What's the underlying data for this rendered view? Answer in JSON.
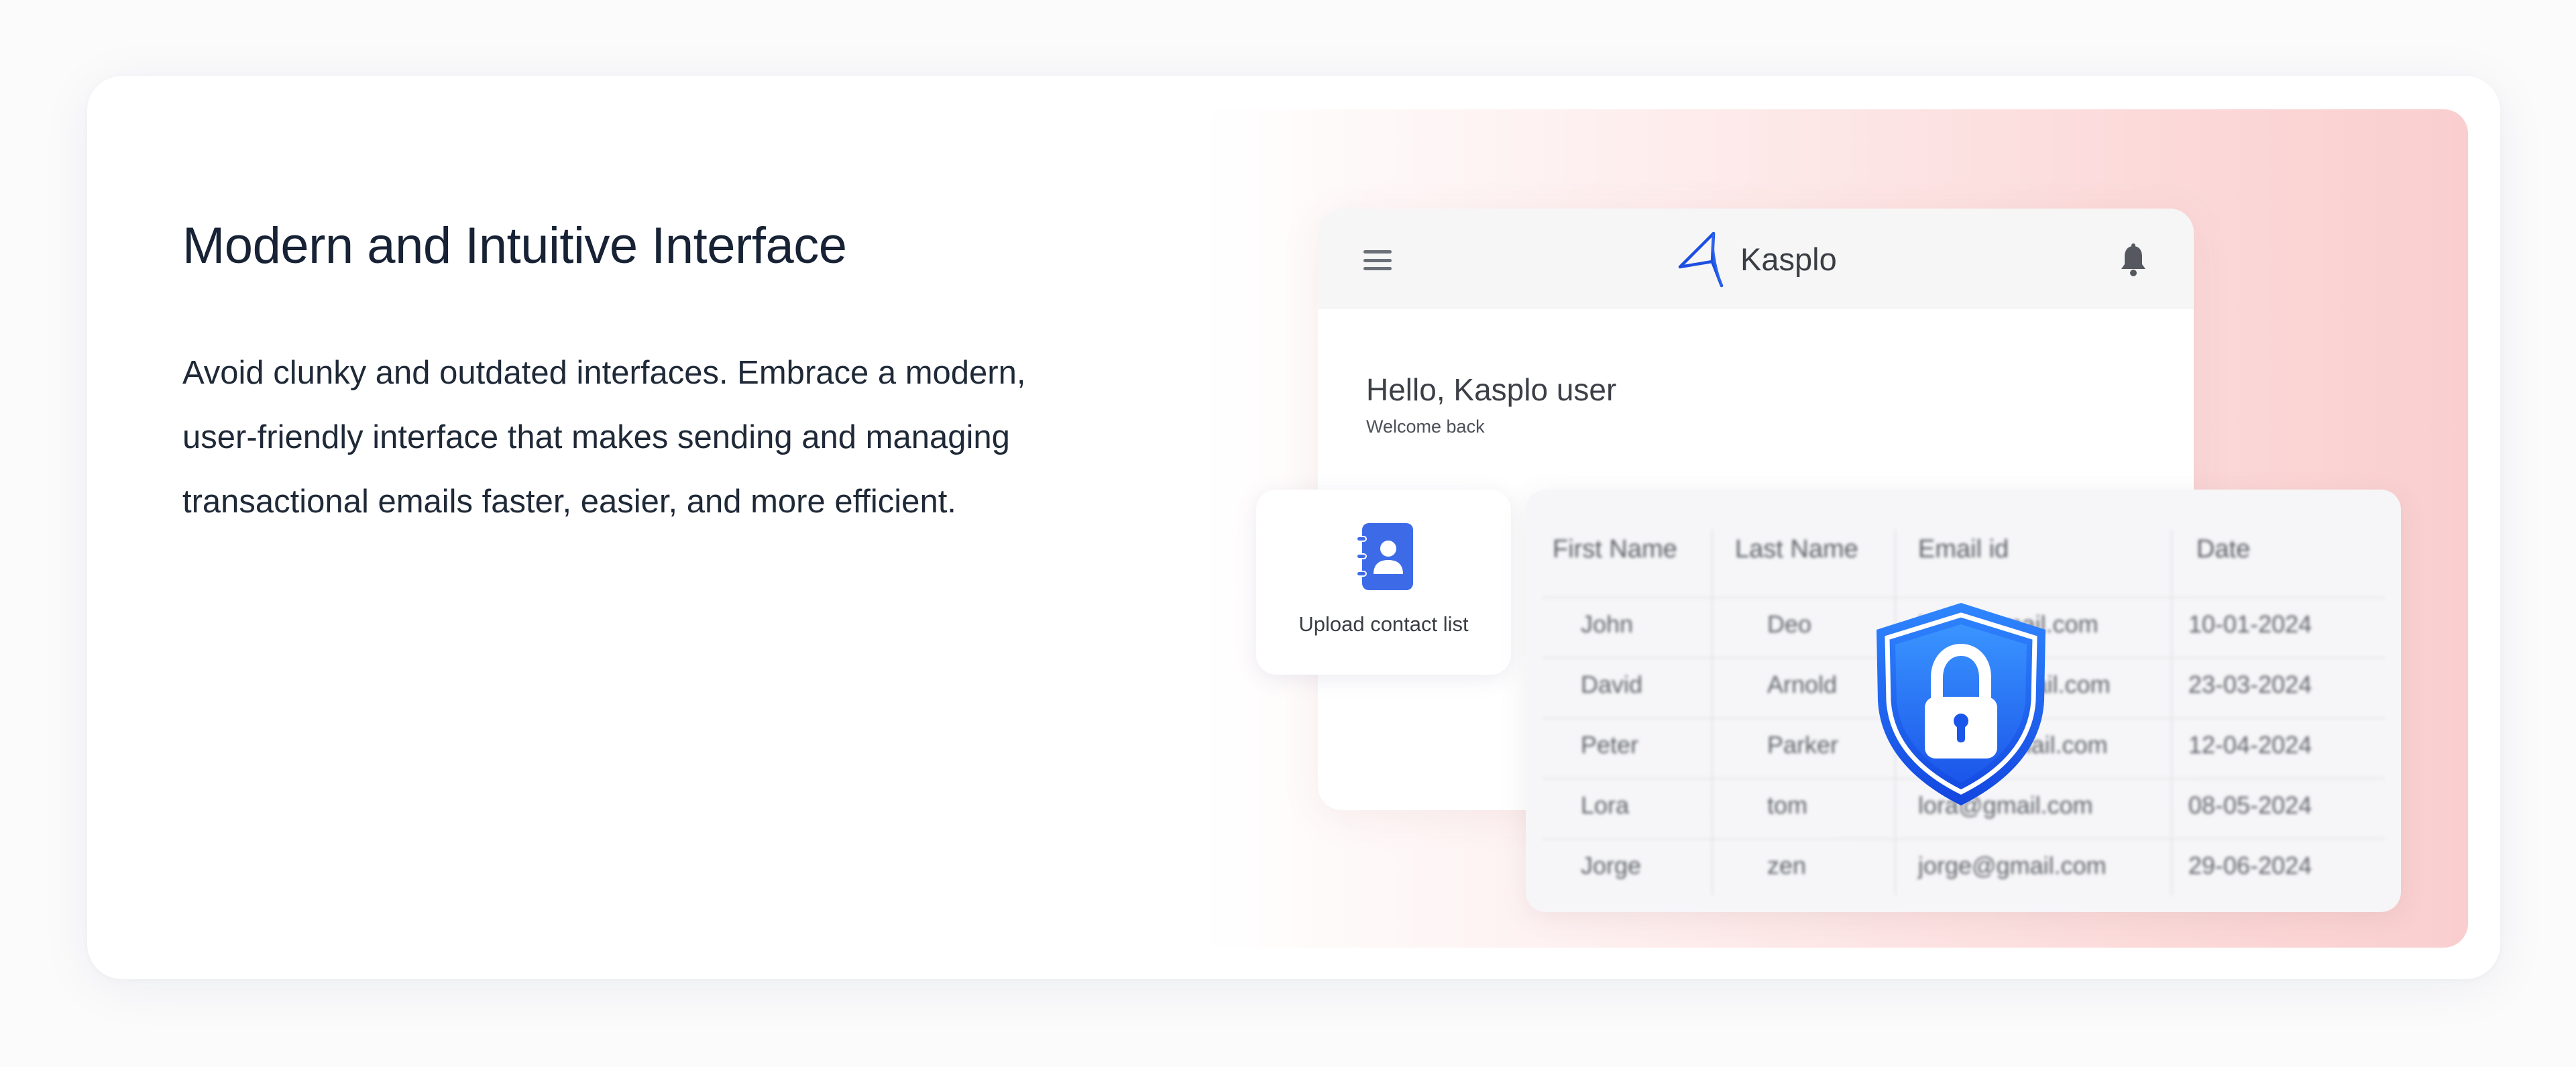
{
  "feature": {
    "title": "Modern and Intuitive Interface",
    "description": "Avoid clunky and outdated interfaces. Embrace a modern, user-friendly interface that makes sending and managing transactional emails faster, easier, and more efficient."
  },
  "app": {
    "brand_name": "Kasplo",
    "greeting": "Hello, Kasplo user",
    "welcome": "Welcome back",
    "upload_label": "Upload contact list"
  },
  "table": {
    "headers": [
      "First Name",
      "Last Name",
      "Email id",
      "Date"
    ],
    "rows": [
      [
        "John",
        "Deo",
        "john@gmail.com",
        "10-01-2024"
      ],
      [
        "David",
        "Arnold",
        "david@gmail.com",
        "23-03-2024"
      ],
      [
        "Peter",
        "Parker",
        "peter@gmail.com",
        "12-04-2024"
      ],
      [
        "Lora",
        "tom",
        "lora@gmail.com",
        "08-05-2024"
      ],
      [
        "Jorge",
        "zen",
        "jorge@gmail.com",
        "29-06-2024"
      ]
    ]
  },
  "icons": {
    "menu": "hamburger-menu-icon",
    "logo": "kasplo-logo-icon",
    "notifications": "bell-icon",
    "contacts": "contact-book-icon",
    "security": "shield-lock-icon"
  },
  "colors": {
    "headline": "#172235",
    "accent_blue": "#1e6cf0",
    "panel_pink": "#facece"
  }
}
